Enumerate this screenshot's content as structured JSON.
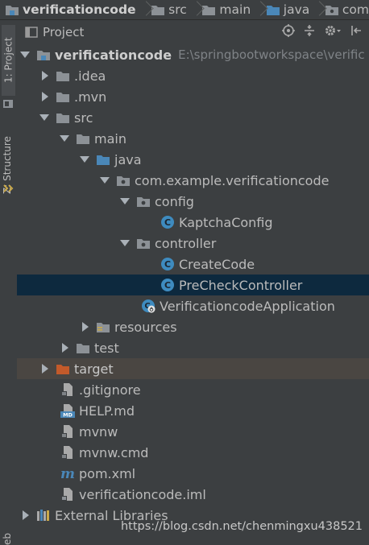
{
  "breadcrumb": [
    {
      "label": "verificationcode",
      "icon": "module-folder-icon"
    },
    {
      "label": "src",
      "icon": "folder-icon"
    },
    {
      "label": "main",
      "icon": "folder-icon"
    },
    {
      "label": "java",
      "icon": "source-folder-icon"
    },
    {
      "label": "com",
      "icon": "package-icon"
    }
  ],
  "side_tabs": {
    "project": "1: Project",
    "structure": "Z: Structure",
    "web": "eb"
  },
  "header": {
    "title": "Project"
  },
  "tree": {
    "root": {
      "label": "verificationcode",
      "path": "E:\\springbootworkspace\\verific"
    },
    "idea": ".idea",
    "mvn": ".mvn",
    "src": "src",
    "main": "main",
    "java": "java",
    "package": "com.example.verificationcode",
    "config": "config",
    "kaptcha": "KaptchaConfig",
    "controller": "controller",
    "create_code": "CreateCode",
    "precheck": "PreCheckController",
    "application": "VerificationcodeApplication",
    "resources": "resources",
    "test": "test",
    "target": "target",
    "gitignore": ".gitignore",
    "help": "HELP.md",
    "mvnw": "mvnw",
    "mvnw_cmd": "mvnw.cmd",
    "pom": "pom.xml",
    "iml": "verificationcode.iml",
    "external": "External Libraries"
  },
  "watermark": "https://blog.csdn.net/chenmingxu438521",
  "colors": {
    "background": "#3c3f41",
    "selection": "#0d293e",
    "excluded_row": "#4a4642",
    "class_icon": "#3e8bbf",
    "folder": "#8c9196",
    "source_folder": "#4a87b8",
    "target_folder": "#c35a2a"
  }
}
